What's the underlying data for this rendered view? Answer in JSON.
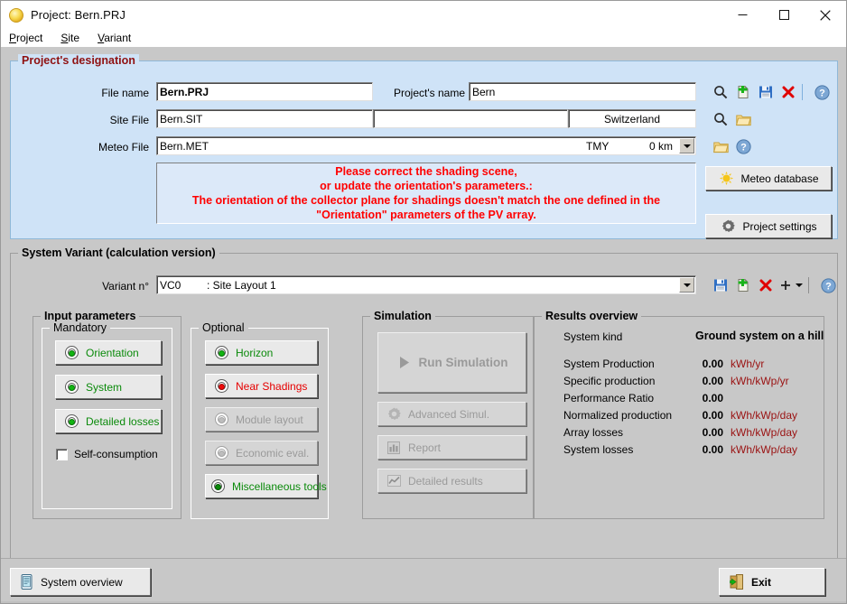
{
  "window": {
    "title": "Project:  Bern.PRJ",
    "app_icon": "sun-icon",
    "minimize_label": "Minimize",
    "maximize_label": "Maximize",
    "close_label": "Close"
  },
  "menu": [
    {
      "label": "Project",
      "accel": "P"
    },
    {
      "label": "Site",
      "accel": "S"
    },
    {
      "label": "Variant",
      "accel": "V"
    }
  ],
  "project": {
    "group_title": "Project's designation",
    "file_name_label": "File name",
    "file_name_value": "Bern.PRJ",
    "project_name_label": "Project's name",
    "project_name_value": "Bern",
    "site_file_label": "Site File",
    "site_file_value": "Bern.SIT",
    "site_region_value": "",
    "site_country_value": "Switzerland",
    "meteo_file_label": "Meteo File",
    "meteo_file_value": "Bern.MET",
    "meteo_kind_value": "TMY",
    "meteo_distance_value": "0 km",
    "toolbar": {
      "search_project": "search-icon",
      "new_project": "new-file-icon",
      "save_project": "save-icon",
      "delete_project": "delete-icon",
      "help_project": "help-icon",
      "search_site": "search-icon",
      "open_site": "folder-icon",
      "open_meteo": "folder-icon",
      "help_meteo": "help-icon"
    },
    "message": "Please correct the shading scene,\nor update the orientation's parameters.:\nThe orientation of the collector plane for shadings doesn't match the one defined  in the \"Orientation\" parameters of the PV array.",
    "meteo_database_label": "Meteo database",
    "project_settings_label": "Project settings"
  },
  "variant": {
    "group_title": "System Variant (calculation version)",
    "variant_label": "Variant n°",
    "variant_id": "VC0",
    "variant_name": ": Site Layout 1",
    "toolbar": {
      "save_variant": "save-icon",
      "new_variant": "new-file-icon",
      "delete_variant": "delete-icon",
      "add_variant": "plus-icon",
      "add_variant_menu": "chevron-down-icon",
      "help_variant": "help-icon"
    }
  },
  "input_parameters": {
    "group_title": "Input parameters",
    "mandatory": {
      "title": "Mandatory",
      "buttons": [
        {
          "label": "Orientation",
          "state": "ok"
        },
        {
          "label": "System",
          "state": "ok"
        },
        {
          "label": "Detailed losses",
          "state": "ok"
        }
      ],
      "checkbox_label": "Self-consumption",
      "checkbox_checked": false
    },
    "optional": {
      "title": "Optional",
      "buttons": [
        {
          "label": "Horizon",
          "state": "ok"
        },
        {
          "label": "Near Shadings",
          "state": "error"
        },
        {
          "label": "Module layout",
          "state": "disabled"
        },
        {
          "label": "Economic eval.",
          "state": "disabled"
        },
        {
          "label": "Miscellaneous tools",
          "state": "ok"
        }
      ]
    }
  },
  "simulation": {
    "group_title": "Simulation",
    "run_label": "Run Simulation",
    "run_icon": "play-icon",
    "buttons": [
      {
        "label": "Advanced Simul.",
        "icon": "gear-icon"
      },
      {
        "label": "Report",
        "icon": "report-icon"
      },
      {
        "label": "Detailed results",
        "icon": "chart-icon"
      }
    ]
  },
  "results": {
    "group_title": "Results overview",
    "system_kind_label": "System kind",
    "system_kind_value": "Ground system on a hill",
    "rows": [
      {
        "label": "System Production",
        "value": "0.00",
        "unit": "kWh/yr"
      },
      {
        "label": "Specific production",
        "value": "0.00",
        "unit": "kWh/kWp/yr"
      },
      {
        "label": "Performance Ratio",
        "value": "0.00",
        "unit": ""
      },
      {
        "label": "Normalized production",
        "value": "0.00",
        "unit": "kWh/kWp/day"
      },
      {
        "label": "Array losses",
        "value": "0.00",
        "unit": "kWh/kWp/day"
      },
      {
        "label": "System losses",
        "value": "0.00",
        "unit": "kWh/kWp/day"
      }
    ]
  },
  "footer": {
    "system_overview_label": "System overview",
    "system_overview_icon": "document-icon",
    "exit_label": "Exit",
    "exit_icon": "exit-door-icon"
  },
  "colors": {
    "panel_blue": "#cfe3f7",
    "group_red": "#8f1111",
    "warning_red": "#ff0000",
    "ok_green": "#0a8a0a",
    "error_red": "#e60000",
    "unit_red": "#9a1111",
    "disabled_gray": "#9a9a9a"
  }
}
